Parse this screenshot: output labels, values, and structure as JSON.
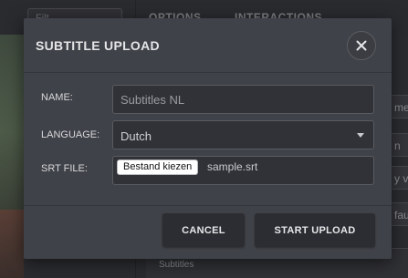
{
  "background": {
    "filter_placeholder": "Filt",
    "tabs": [
      "OPTIONS",
      "INTERACTIONS"
    ],
    "right_fragments": [
      "ment",
      "n",
      "y vi",
      "faul"
    ],
    "subtitles_label": "Subtitles"
  },
  "modal": {
    "title": "SUBTITLE UPLOAD",
    "close_icon": "close-icon",
    "fields": {
      "name": {
        "label": "NAME:",
        "value": "Subtitles NL"
      },
      "language": {
        "label": "LANGUAGE:",
        "value": "Dutch"
      },
      "srt_file": {
        "label": "SRT FILE:",
        "button_label": "Bestand kiezen",
        "file_name": "sample.srt"
      }
    },
    "buttons": {
      "cancel": "CANCEL",
      "start_upload": "START UPLOAD"
    }
  },
  "colors": {
    "modal_bg": "#404249",
    "input_bg": "#313238",
    "button_bg": "#2c2d32",
    "page_bg": "#2b2c30"
  }
}
